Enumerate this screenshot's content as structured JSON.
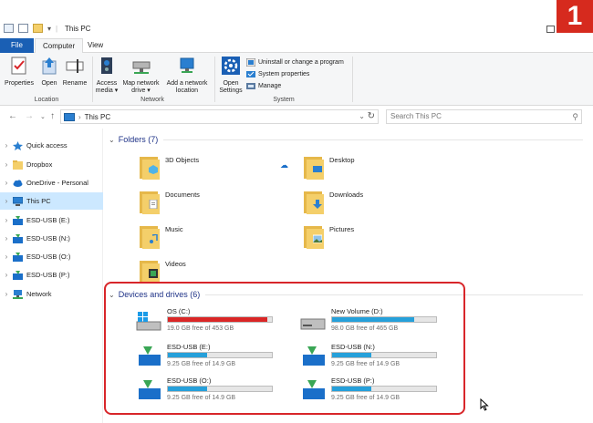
{
  "window": {
    "title": "This PC",
    "badge": "1"
  },
  "ribbon_tabs": [
    "File",
    "Computer",
    "View"
  ],
  "ribbon": {
    "location": {
      "label": "Location",
      "buttons": [
        "Properties",
        "Open",
        "Rename"
      ]
    },
    "network": {
      "label": "Network",
      "access_media": "Access media ▾",
      "map_drive": "Map network drive ▾",
      "add_location": "Add a network location"
    },
    "system": {
      "label": "System",
      "open_settings": "Open Settings",
      "uninstall": "Uninstall or change a program",
      "system_properties": "System properties",
      "manage": "Manage"
    }
  },
  "address": {
    "path": "This PC",
    "search_placeholder": "Search This PC"
  },
  "sidebar": {
    "items": [
      {
        "label": "Quick access",
        "icon": "star-icon"
      },
      {
        "label": "Dropbox",
        "icon": "folder-icon"
      },
      {
        "label": "OneDrive - Personal",
        "icon": "cloud-icon"
      },
      {
        "label": "This PC",
        "icon": "computer-icon",
        "active": true
      },
      {
        "label": "ESD-USB (E:)",
        "icon": "usb-drive-icon"
      },
      {
        "label": "ESD-USB (N:)",
        "icon": "usb-drive-icon"
      },
      {
        "label": "ESD-USB (O:)",
        "icon": "usb-drive-icon"
      },
      {
        "label": "ESD-USB (P:)",
        "icon": "usb-drive-icon"
      },
      {
        "label": "Network",
        "icon": "network-icon"
      }
    ]
  },
  "folders": {
    "header": "Folders (7)",
    "items": [
      "3D Objects",
      "Desktop",
      "Documents",
      "Downloads",
      "Music",
      "Pictures",
      "Videos"
    ]
  },
  "drives": {
    "header": "Devices and drives (6)",
    "items": [
      {
        "name": "OS (C:)",
        "free": "19.0 GB free of 453 GB",
        "used_fraction": 0.96,
        "color": "#da2626"
      },
      {
        "name": "New Volume (D:)",
        "free": "98.0 GB free of 465 GB",
        "used_fraction": 0.79,
        "color": "#26a0da"
      },
      {
        "name": "ESD-USB (E:)",
        "free": "9.25 GB free of 14.9 GB",
        "used_fraction": 0.38,
        "color": "#26a0da"
      },
      {
        "name": "ESD-USB (N:)",
        "free": "9.25 GB free of 14.9 GB",
        "used_fraction": 0.38,
        "color": "#26a0da"
      },
      {
        "name": "ESD-USB (O:)",
        "free": "9.25 GB free of 14.9 GB",
        "used_fraction": 0.38,
        "color": "#26a0da"
      },
      {
        "name": "ESD-USB (P:)",
        "free": "9.25 GB free of 14.9 GB",
        "used_fraction": 0.38,
        "color": "#26a0da"
      }
    ]
  },
  "colors": {
    "accent": "#1a5fb4",
    "highlight_box": "#d8262a",
    "badge": "#d62a1e"
  }
}
